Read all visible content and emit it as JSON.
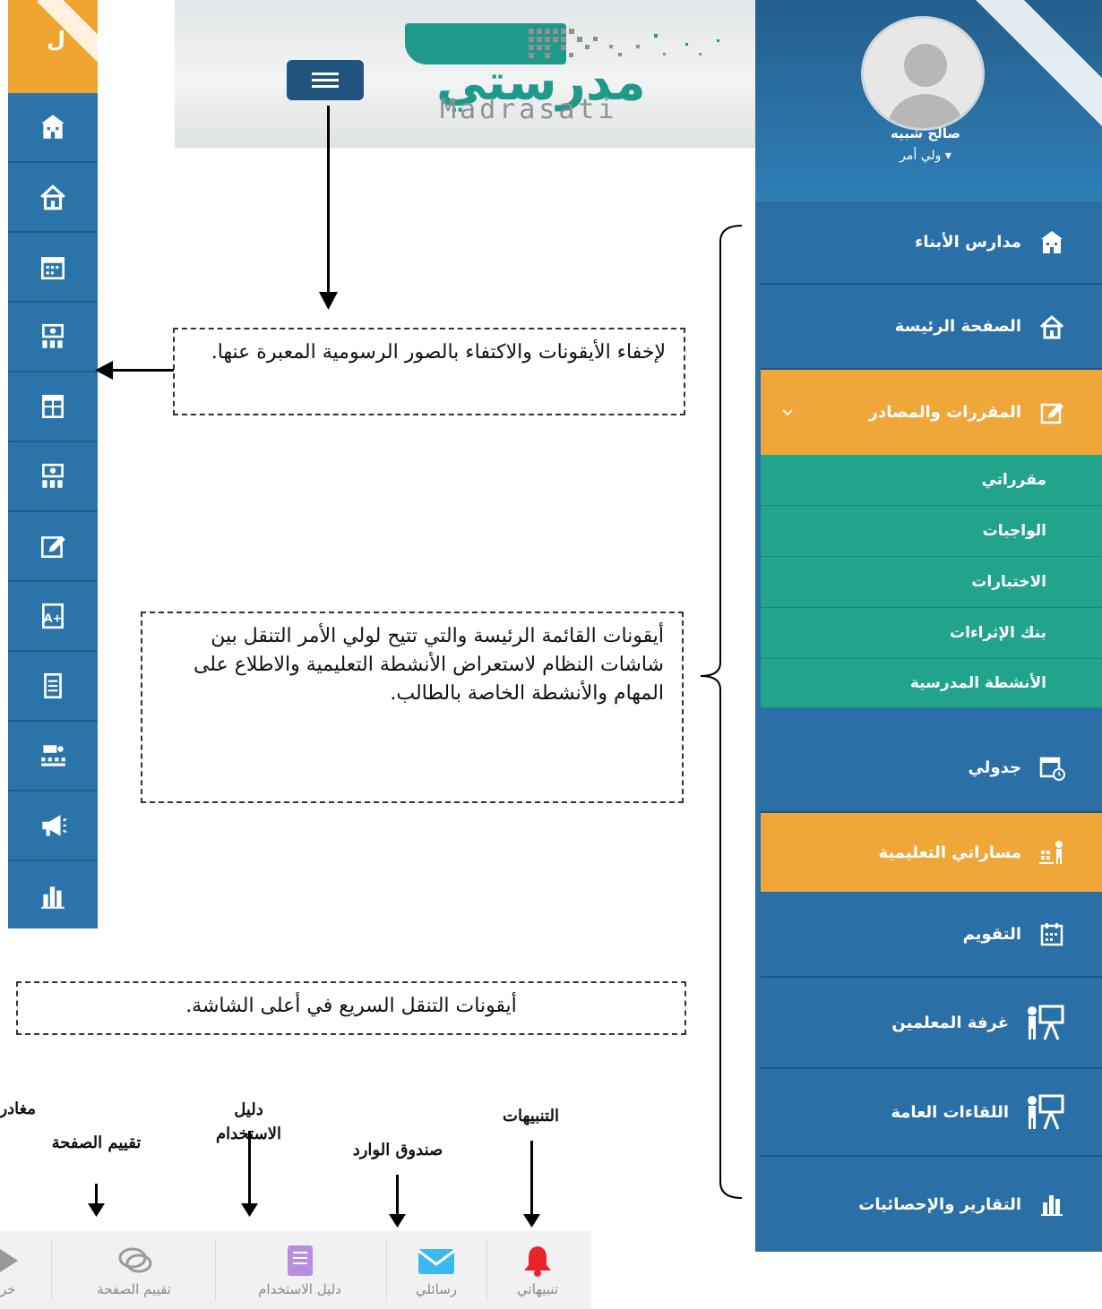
{
  "mini_sidebar": {
    "top_text": "ل",
    "icons": [
      "schools-icon",
      "home-icon",
      "calendar-icon",
      "classroom-icon",
      "table-icon",
      "classroom-icon",
      "edit-icon",
      "grade-icon",
      "document-icon",
      "hierarchy-icon",
      "megaphone-icon",
      "bar-chart-icon"
    ]
  },
  "logo": {
    "arabic": "مدرستي",
    "english": "Madrasati"
  },
  "profile": {
    "name": "صالح شبيه",
    "role": "ولي أمر ▾"
  },
  "sidebar": {
    "items": [
      {
        "label": "مدارس الأبناء",
        "icon": "schools-icon"
      },
      {
        "label": "الصفحة الرئيسة",
        "icon": "home-icon"
      },
      {
        "label": "المقررات والمصادر",
        "icon": "edit-icon"
      },
      {
        "label": "جدولي",
        "icon": "schedule-icon"
      },
      {
        "label": "مساراتي التعليمية",
        "icon": "learning-path-icon"
      },
      {
        "label": "التقويم",
        "icon": "calendar-icon"
      },
      {
        "label": "غرفة المعلمين",
        "icon": "presentation-icon"
      },
      {
        "label": "اللقاءات العامة",
        "icon": "presentation-icon"
      },
      {
        "label": "التقارير والإحصائيات",
        "icon": "bar-chart-icon"
      }
    ],
    "subitems": [
      "مقرراتي",
      "الواجبات",
      "الاختبارات",
      "بنك الإثراءات",
      "الأنشطة المدرسية"
    ],
    "colors": {
      "blue": "#2a6fa5",
      "orange": "#f0a73a",
      "teal": "#22a38b"
    }
  },
  "notes": {
    "hide_icons": "لإخفاء الأيقونات والاكتفاء بالصور الرسومية المعبرة عنها.",
    "main_menu": "أيقونات القائمة الرئيسة والتي تتيح لولي الأمر التنقل بين شاشات النظام لاستعراض الأنشطة التعليمية والاطلاع على المهام والأنشطة الخاصة بالطالب.",
    "quick_nav": "أيقونات التنقل السريع في أعلى الشاشة."
  },
  "bottom_labels": {
    "exit": "مغادر",
    "rating": "تقييم الصفحة",
    "guide": "دليل الاستخدام",
    "inbox": "صندوق الوارد",
    "alerts": "التنبيهات"
  },
  "toolbar": {
    "exit": "خر",
    "rating": "تقييم الصفحة",
    "guide": "دليل الاستخدام",
    "messages": "رسائلي",
    "alerts": "تنبيهاتي"
  }
}
